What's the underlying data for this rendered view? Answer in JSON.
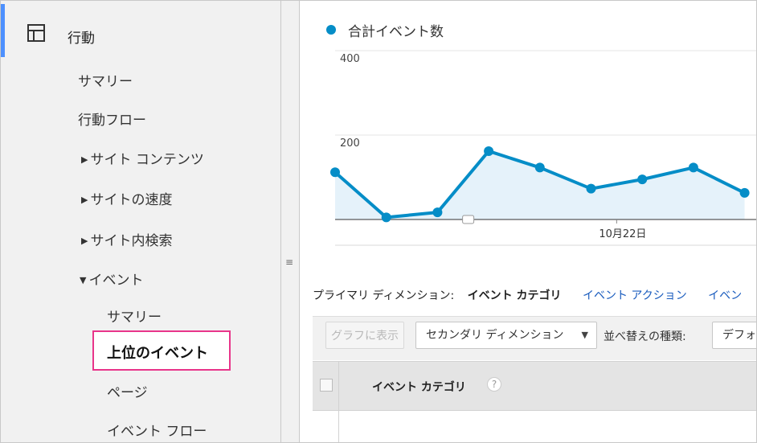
{
  "sidebar": {
    "section_label": "行動",
    "items": [
      {
        "label": "サマリー"
      },
      {
        "label": "行動フロー"
      },
      {
        "label": "サイト コンテンツ",
        "arrow": "▶"
      },
      {
        "label": "サイトの速度",
        "arrow": "▶"
      },
      {
        "label": "サイト内検索",
        "arrow": "▶"
      },
      {
        "label": "イベント",
        "arrow": "▼"
      }
    ],
    "sub_items": [
      {
        "label": "サマリー"
      },
      {
        "label": "上位のイベント"
      },
      {
        "label": "ページ"
      },
      {
        "label": "イベント フロー"
      }
    ]
  },
  "chart": {
    "legend_label": "合計イベント数",
    "accent_color": "#058dc7",
    "fill_color": "#e5f2fa"
  },
  "chart_data": {
    "type": "area",
    "series": [
      {
        "name": "合計イベント数",
        "values": [
          112,
          5,
          17,
          162,
          123,
          73,
          95,
          123,
          63
        ]
      }
    ],
    "y_ticks": [
      {
        "value": 400,
        "label": "400"
      },
      {
        "value": 200,
        "label": "200"
      }
    ],
    "x_ticks": [
      {
        "index": 5.5,
        "label": "10月22日"
      }
    ],
    "ylim": [
      0,
      400
    ],
    "grid": true,
    "annotation_marker_index": 2.6
  },
  "dimensions": {
    "label": "プライマリ ディメンション:",
    "active": "イベント カテゴリ",
    "link1": "イベント アクション",
    "link2": "イベン"
  },
  "toolbar": {
    "graph_button": "グラフに表示",
    "secondary_dimension": "セカンダリ ディメンション",
    "sort_label": "並べ替えの種類:",
    "sort_value": "デフォ"
  },
  "table": {
    "column_header": "イベント カテゴリ",
    "help_symbol": "?"
  }
}
